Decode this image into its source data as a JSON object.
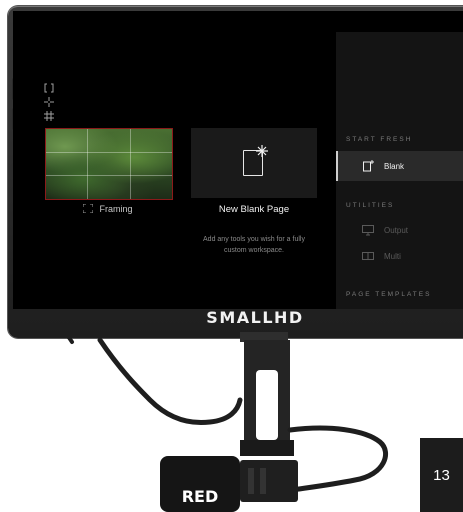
{
  "brand": {
    "logo": "SMALLHD"
  },
  "screen": {
    "tool_icons": [
      "bracket-icon",
      "crosshair-icon",
      "grid-icon"
    ],
    "tiles": [
      {
        "caption": "Framing",
        "icon": "framing-icon",
        "thumbnail": "jungle-thumbnail"
      },
      {
        "caption": "New Blank Page",
        "icon": "page-icon",
        "description": "Add any tools you wish for a fully custom workspace."
      }
    ],
    "menu": {
      "start_fresh_header": "START FRESH",
      "blank_label": "Blank",
      "utilities_header": "UTILITIES",
      "output_label": "Output",
      "multi_label": "Multi",
      "page_templates_header": "PAGE TEMPLATES"
    }
  },
  "module": {
    "logo": "RED"
  },
  "page": {
    "number": "13"
  },
  "colors": {
    "framing_border": "#8b1a1a",
    "module_logo_text": "#ffffff"
  }
}
